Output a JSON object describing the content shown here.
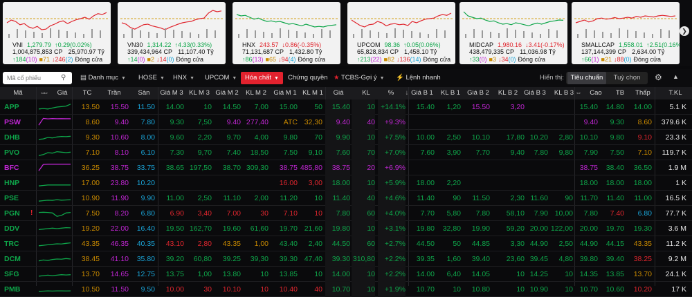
{
  "colors": {
    "up": "#0ea64a",
    "down": "#e0262e",
    "ref": "#c98a00",
    "ceil": "#c026d3",
    "floor": "#1aa3d6",
    "accent": "#e3222e"
  },
  "indices": [
    {
      "name": "VNI",
      "value": "1,279.79",
      "change": "0.29(0.02%)",
      "dir": "up",
      "volume": "1,004,875,853 CP",
      "amount": "25,970.97 Tỷ",
      "adv": "184",
      "adv_c": "(10)",
      "ref": "71",
      "dec": "246",
      "dec_f": "(2)",
      "status": "Đóng cửa",
      "line": [
        0.55,
        0.45,
        0.5,
        0.62,
        0.58,
        0.7,
        0.75,
        0.68,
        0.8,
        0.78,
        0.66,
        0.6,
        0.52,
        0.48,
        0.58,
        0.5,
        0.44,
        0.4,
        0.35,
        0.42,
        0.3,
        0.22,
        0.25,
        0.18
      ]
    },
    {
      "name": "VN30",
      "value": "1,314.22",
      "change": "4.33(0.33%)",
      "dir": "up",
      "volume": "339,434,964 CP",
      "amount": "11,107.40 Tỷ",
      "adv": "14",
      "adv_c": "(0)",
      "ref": "2",
      "dec": "14",
      "dec_f": "(0)",
      "status": "Đóng cửa",
      "line": [
        0.55,
        0.6,
        0.72,
        0.78,
        0.7,
        0.62,
        0.6,
        0.66,
        0.7,
        0.74,
        0.8,
        0.72,
        0.66,
        0.6,
        0.55,
        0.52,
        0.5,
        0.44,
        0.4,
        0.38,
        0.2,
        0.1,
        0.15,
        0.12
      ]
    },
    {
      "name": "HNX",
      "value": "243.57",
      "change": "0.86(-0.35%)",
      "dir": "down",
      "volume": "71,131,687 CP",
      "amount": "1,432.80 Tỷ",
      "adv": "86",
      "adv_c": "(13)",
      "ref": "65",
      "dec": "94",
      "dec_f": "(4)",
      "status": "Đóng cửa",
      "line": [
        0.25,
        0.3,
        0.28,
        0.35,
        0.42,
        0.38,
        0.45,
        0.5,
        0.48,
        0.52,
        0.5,
        0.55,
        0.6,
        0.58,
        0.62,
        0.66,
        0.6,
        0.65,
        0.7,
        0.68,
        0.7,
        0.66,
        0.64,
        0.62
      ]
    },
    {
      "name": "UPCOM",
      "value": "98.36",
      "change": "0.05(0.06%)",
      "dir": "up",
      "volume": "65,828,834 CP",
      "amount": "1,458.10 Tỷ",
      "adv": "213",
      "adv_c": "(22)",
      "ref": "82",
      "dec": "136",
      "dec_f": "(14)",
      "status": "Đóng cửa",
      "line": [
        0.45,
        0.55,
        0.65,
        0.7,
        0.62,
        0.6,
        0.5,
        0.55,
        0.66,
        0.6,
        0.58,
        0.62,
        0.6,
        0.65,
        0.5,
        0.55,
        0.48,
        0.42,
        0.4,
        0.38,
        0.3,
        0.25,
        0.28,
        0.2
      ]
    },
    {
      "name": "MIDCAP",
      "value": "1,980.16",
      "change": "3.41(-0.17%)",
      "dir": "down",
      "volume": "438,479,335 CP",
      "amount": "11,036.98 Tỷ",
      "adv": "33",
      "adv_c": "(0)",
      "ref": "3",
      "dec": "34",
      "dec_f": "(0)",
      "status": "Đóng cửa",
      "line": [
        0.15,
        0.3,
        0.35,
        0.4,
        0.38,
        0.45,
        0.5,
        0.48,
        0.55,
        0.6,
        0.58,
        0.62,
        0.55,
        0.58,
        0.62,
        0.66,
        0.6,
        0.56,
        0.6,
        0.55,
        0.5,
        0.48,
        0.45,
        0.46
      ]
    },
    {
      "name": "SMALLCAP",
      "value": "1,558.01",
      "change": "2.51(0.16%)",
      "dir": "up",
      "volume": "137,144,399 CP",
      "amount": "2,634.00 Tỷ",
      "adv": "66",
      "adv_c": "(1)",
      "ref": "21",
      "dec": "88",
      "dec_f": "(0)",
      "status": "Đóng cửa",
      "line": [
        0.55,
        0.5,
        0.45,
        0.52,
        0.48,
        0.4,
        0.38,
        0.42,
        0.4,
        0.36,
        0.4,
        0.38,
        0.35,
        0.38,
        0.32,
        0.35,
        0.3,
        0.32,
        0.34,
        0.3,
        0.28,
        0.3,
        0.32,
        0.3
      ]
    }
  ],
  "toolbar": {
    "search_placeholder": "Mã cổ phiếu",
    "menu": [
      "Danh mục",
      "HOSE",
      "HNX",
      "UPCOM"
    ],
    "active": "Hóa chất",
    "chung_quyen": "Chứng quyền",
    "tcbs": "TCBS-Gợi ý",
    "lenh_nhanh": "Lệnh nhanh",
    "view_label": "Hiển thị:",
    "view_opts": [
      "Tiêu chuẩn",
      "Tuỳ chọn"
    ]
  },
  "headers": [
    "Mã",
    "",
    "Giá",
    "TC",
    "Trần",
    "Sàn",
    "Giá M 3",
    "KL M 3",
    "Giá M 2",
    "KL M 2",
    "Giá M 1",
    "KL M 1",
    "Giá",
    "KL",
    "%",
    "Giá B 1",
    "KL B 1",
    "Giá B 2",
    "KL B 2",
    "Giá B 3",
    "KL B 3",
    "",
    "Cao",
    "TB",
    "Thấp",
    "T.KL"
  ],
  "rows": [
    {
      "sym": "APP",
      "color": "up",
      "tc": "13.50",
      "tran": "15.50",
      "san": "11.50",
      "gm3": [
        "14.00",
        "up"
      ],
      "klm3": "10",
      "gm2": [
        "14.50",
        "up"
      ],
      "klm2": "7,00",
      "gm1": [
        "15.00",
        "up"
      ],
      "klm1": "50",
      "gia": [
        "15.40",
        "up"
      ],
      "kl": "10",
      "pct": "+14.1%",
      "gb1": [
        "15.40",
        "up"
      ],
      "klb1": "1,20",
      "gb2": [
        "15.50",
        "ce"
      ],
      "klb2": "3,20",
      "gb3": [
        "",
        ""
      ],
      "klb3": "",
      "cao": [
        "15.40",
        "up"
      ],
      "tb": [
        "14.80",
        "up"
      ],
      "thap": [
        "14.00",
        "up"
      ],
      "tkl": "5.1 K",
      "spark": [
        0.3,
        0.35,
        0.3,
        0.4,
        0.5,
        0.55,
        0.6,
        0.8
      ]
    },
    {
      "sym": "PSW",
      "color": "ce",
      "tc": "8.60",
      "tran": "9.40",
      "san": "7.80",
      "gm3": [
        "9.30",
        "up"
      ],
      "klm3": "7,50",
      "gm2": [
        "9.40",
        "ce"
      ],
      "klm2": "277,40",
      "gm1": [
        "ATC",
        "ye"
      ],
      "klm1": "32,30",
      "gia": [
        "9.40",
        "ce"
      ],
      "kl": "40",
      "pct": "+9.3%",
      "gb1": [
        "",
        ""
      ],
      "klb1": "",
      "gb2": [
        "",
        ""
      ],
      "klb2": "",
      "gb3": [
        "",
        ""
      ],
      "klb3": "",
      "cao": [
        "9.40",
        "ce"
      ],
      "tb": [
        "9.30",
        "up"
      ],
      "thap": [
        "8.60",
        "ye"
      ],
      "tkl": "379.6 K",
      "spark": [
        0.2,
        0.9,
        0.85,
        0.88,
        0.86,
        0.87,
        0.86,
        0.86
      ]
    },
    {
      "sym": "DHB",
      "color": "up",
      "tc": "9.30",
      "tran": "10.60",
      "san": "8.00",
      "gm3": [
        "9.60",
        "up"
      ],
      "klm3": "2,20",
      "gm2": [
        "9.70",
        "up"
      ],
      "klm2": "4,00",
      "gm1": [
        "9.80",
        "up"
      ],
      "klm1": "70",
      "gia": [
        "9.90",
        "up"
      ],
      "kl": "10",
      "pct": "+7.5%",
      "gb1": [
        "10.00",
        "up"
      ],
      "klb1": "2,50",
      "gb2": [
        "10.10",
        "up"
      ],
      "klb2": "17,80",
      "gb3": [
        "10.20",
        "up"
      ],
      "klb3": "2,80",
      "cao": [
        "10.10",
        "up"
      ],
      "tb": [
        "9.80",
        "up"
      ],
      "thap": [
        "9.10",
        "dn"
      ],
      "tkl": "23.3 K",
      "spark": [
        0.3,
        0.35,
        0.5,
        0.45,
        0.55,
        0.6,
        0.58,
        0.62
      ]
    },
    {
      "sym": "PVO",
      "color": "up",
      "tc": "7.10",
      "tran": "8.10",
      "san": "6.10",
      "gm3": [
        "7.30",
        "up"
      ],
      "klm3": "9,70",
      "gm2": [
        "7.40",
        "up"
      ],
      "klm2": "18,50",
      "gm1": [
        "7.50",
        "up"
      ],
      "klm1": "9,10",
      "gia": [
        "7.60",
        "up"
      ],
      "kl": "70",
      "pct": "+7.0%",
      "gb1": [
        "7.60",
        "up"
      ],
      "klb1": "3,90",
      "gb2": [
        "7.70",
        "up"
      ],
      "klb2": "9,40",
      "gb3": [
        "7.80",
        "up"
      ],
      "klb3": "9,80",
      "cao": [
        "7.90",
        "up"
      ],
      "tb": [
        "7.50",
        "up"
      ],
      "thap": [
        "7.10",
        "ye"
      ],
      "tkl": "119.7 K",
      "spark": [
        0.2,
        0.3,
        0.5,
        0.45,
        0.6,
        0.55,
        0.5,
        0.55
      ]
    },
    {
      "sym": "BFC",
      "color": "ce",
      "tc": "36.25",
      "tran": "38.75",
      "san": "33.75",
      "gm3": [
        "38.65",
        "up"
      ],
      "klm3": "197,50",
      "gm2": [
        "38.70",
        "up"
      ],
      "klm2": "309,30",
      "gm1": [
        "38.75",
        "ce"
      ],
      "klm1": "485,80",
      "gia": [
        "38.75",
        "ce"
      ],
      "kl": "20",
      "pct": "+6.9%",
      "gb1": [
        "",
        ""
      ],
      "klb1": "",
      "gb2": [
        "",
        ""
      ],
      "klb2": "",
      "gb3": [
        "",
        ""
      ],
      "klb3": "",
      "cao": [
        "38.75",
        "ce"
      ],
      "tb": [
        "38.40",
        "up"
      ],
      "thap": [
        "36.50",
        "up"
      ],
      "tkl": "1.9 M",
      "spark": [
        0.2,
        0.85,
        0.88,
        0.88,
        0.88,
        0.88,
        0.88,
        0.88
      ]
    },
    {
      "sym": "HNP",
      "color": "up",
      "tc": "17.00",
      "tran": "23.80",
      "san": "10.20",
      "gm3": [
        "",
        ""
      ],
      "klm3": "",
      "gm2": [
        "",
        ""
      ],
      "klm2": "",
      "gm1": [
        "16.00",
        "dn"
      ],
      "klm1": "3,00",
      "gia": [
        "18.00",
        "up"
      ],
      "kl": "10",
      "pct": "+5.9%",
      "gb1": [
        "18.00",
        "up"
      ],
      "klb1": "2,20",
      "gb2": [
        "",
        ""
      ],
      "klb2": "",
      "gb3": [
        "",
        ""
      ],
      "klb3": "",
      "cao": [
        "18.00",
        "up"
      ],
      "tb": [
        "18.00",
        "up"
      ],
      "thap": [
        "18.00",
        "up"
      ],
      "tkl": "1 K",
      "spark": [
        0.2,
        0.25,
        0.3,
        0.3,
        0.3,
        0.3,
        0.3,
        0.3
      ]
    },
    {
      "sym": "PSE",
      "color": "up",
      "tc": "10.90",
      "tran": "11.90",
      "san": "9.90",
      "gm3": [
        "11.00",
        "up"
      ],
      "klm3": "2,50",
      "gm2": [
        "11.10",
        "up"
      ],
      "klm2": "2,00",
      "gm1": [
        "11.20",
        "up"
      ],
      "klm1": "10",
      "gia": [
        "11.40",
        "up"
      ],
      "kl": "40",
      "pct": "+4.6%",
      "gb1": [
        "11.40",
        "up"
      ],
      "klb1": "90",
      "gb2": [
        "11.50",
        "up"
      ],
      "klb2": "2,30",
      "gb3": [
        "11.60",
        "up"
      ],
      "klb3": "90",
      "cao": [
        "11.70",
        "up"
      ],
      "tb": [
        "11.40",
        "up"
      ],
      "thap": [
        "11.00",
        "up"
      ],
      "tkl": "16.5 K",
      "spark": [
        0.2,
        0.25,
        0.3,
        0.28,
        0.35,
        0.3,
        0.32,
        0.35
      ]
    },
    {
      "sym": "PGN",
      "color": "up",
      "mark": "!",
      "tc": "7.50",
      "tran": "8.20",
      "san": "6.80",
      "gm3": [
        "6.90",
        "dn"
      ],
      "klm3": "3,40",
      "gm2": [
        "7.00",
        "dn"
      ],
      "klm2": "30",
      "gm1": [
        "7.10",
        "dn"
      ],
      "klm1": "10",
      "gia": [
        "7.80",
        "up"
      ],
      "kl": "60",
      "pct": "+4.0%",
      "gb1": [
        "7.70",
        "up"
      ],
      "klb1": "5,80",
      "gb2": [
        "7.80",
        "up"
      ],
      "klb2": "58,10",
      "gb3": [
        "7.90",
        "up"
      ],
      "klb3": "10,00",
      "cao": [
        "7.80",
        "up"
      ],
      "tb": [
        "7.40",
        "dn"
      ],
      "thap": [
        "6.80",
        "fl"
      ],
      "tkl": "77.7 K",
      "spark": [
        0.6,
        0.62,
        0.6,
        0.55,
        0.2,
        0.3,
        0.55,
        0.6
      ]
    },
    {
      "sym": "DDV",
      "color": "up",
      "tc": "19.20",
      "tran": "22.00",
      "san": "16.40",
      "gm3": [
        "19.50",
        "up"
      ],
      "klm3": "162,70",
      "gm2": [
        "19.60",
        "up"
      ],
      "klm2": "61,60",
      "gm1": [
        "19.70",
        "up"
      ],
      "klm1": "21,60",
      "gia": [
        "19.80",
        "up"
      ],
      "kl": "10",
      "pct": "+3.1%",
      "gb1": [
        "19.80",
        "up"
      ],
      "klb1": "32,80",
      "gb2": [
        "19.90",
        "up"
      ],
      "klb2": "59,20",
      "gb3": [
        "20.00",
        "up"
      ],
      "klb3": "122,00",
      "cao": [
        "20.00",
        "up"
      ],
      "tb": [
        "19.70",
        "up"
      ],
      "thap": [
        "19.30",
        "up"
      ],
      "tkl": "3.6 M",
      "spark": [
        0.4,
        0.45,
        0.5,
        0.55,
        0.5,
        0.55,
        0.6,
        0.58
      ]
    },
    {
      "sym": "TRC",
      "color": "up",
      "tc": "43.35",
      "tran": "46.35",
      "san": "40.35",
      "gm3": [
        "43.10",
        "dn"
      ],
      "klm3": "2,80",
      "gm2": [
        "43.35",
        "ye"
      ],
      "klm2": "1,00",
      "gm1": [
        "43.40",
        "up"
      ],
      "klm1": "2,40",
      "gia": [
        "44.50",
        "up"
      ],
      "kl": "60",
      "pct": "+2.7%",
      "gb1": [
        "44.50",
        "up"
      ],
      "klb1": "50",
      "gb2": [
        "44.85",
        "up"
      ],
      "klb2": "3,30",
      "gb3": [
        "44.90",
        "up"
      ],
      "klb3": "2,50",
      "cao": [
        "44.90",
        "up"
      ],
      "tb": [
        "44.15",
        "up"
      ],
      "thap": [
        "43.35",
        "ye"
      ],
      "tkl": "11.2 K",
      "spark": [
        0.3,
        0.35,
        0.4,
        0.45,
        0.5,
        0.48,
        0.55,
        0.6
      ]
    },
    {
      "sym": "DCM",
      "color": "up",
      "tc": "38.45",
      "tran": "41.10",
      "san": "35.80",
      "gm3": [
        "39.20",
        "up"
      ],
      "klm3": "60,80",
      "gm2": [
        "39.25",
        "up"
      ],
      "klm2": "39,30",
      "gm1": [
        "39.30",
        "up"
      ],
      "klm1": "47,40",
      "gia": [
        "39.30",
        "up"
      ],
      "kl": "310,80",
      "pct": "+2.2%",
      "gb1": [
        "39.35",
        "up"
      ],
      "klb1": "1,60",
      "gb2": [
        "39.40",
        "up"
      ],
      "klb2": "23,60",
      "gb3": [
        "39.45",
        "up"
      ],
      "klb3": "4,80",
      "cao": [
        "39.80",
        "up"
      ],
      "tb": [
        "39.40",
        "up"
      ],
      "thap": [
        "38.25",
        "dn"
      ],
      "tkl": "9.2 M",
      "spark": [
        0.3,
        0.4,
        0.35,
        0.45,
        0.5,
        0.48,
        0.55,
        0.5
      ]
    },
    {
      "sym": "SFG",
      "color": "up",
      "tc": "13.70",
      "tran": "14.65",
      "san": "12.75",
      "gm3": [
        "13.75",
        "up"
      ],
      "klm3": "1,00",
      "gm2": [
        "13.80",
        "up"
      ],
      "klm2": "10",
      "gm1": [
        "13.85",
        "up"
      ],
      "klm1": "10",
      "gia": [
        "14.00",
        "up"
      ],
      "kl": "10",
      "pct": "+2.2%",
      "gb1": [
        "14.00",
        "up"
      ],
      "klb1": "6,40",
      "gb2": [
        "14.05",
        "up"
      ],
      "klb2": "10",
      "gb3": [
        "14.25",
        "up"
      ],
      "klb3": "10",
      "cao": [
        "14.35",
        "up"
      ],
      "tb": [
        "13.85",
        "up"
      ],
      "thap": [
        "13.70",
        "ye"
      ],
      "tkl": "24.1 K",
      "spark": [
        0.3,
        0.35,
        0.4,
        0.35,
        0.4,
        0.45,
        0.42,
        0.45
      ]
    },
    {
      "sym": "PMB",
      "color": "up",
      "tc": "10.50",
      "tran": "11.50",
      "san": "9.50",
      "gm3": [
        "10.00",
        "dn"
      ],
      "klm3": "30",
      "gm2": [
        "10.10",
        "dn"
      ],
      "klm2": "10",
      "gm1": [
        "10.40",
        "dn"
      ],
      "klm1": "40",
      "gia": [
        "10.70",
        "up"
      ],
      "kl": "10",
      "pct": "+1.9%",
      "gb1": [
        "10.70",
        "up"
      ],
      "klb1": "10",
      "gb2": [
        "10.80",
        "up"
      ],
      "klb2": "10",
      "gb3": [
        "10.90",
        "up"
      ],
      "klb3": "10",
      "cao": [
        "10.70",
        "up"
      ],
      "tb": [
        "10.60",
        "up"
      ],
      "thap": [
        "10.20",
        "dn"
      ],
      "tkl": "17 K",
      "spark": [
        0.3,
        0.32,
        0.35,
        0.33,
        0.35,
        0.35,
        0.34,
        0.35
      ]
    }
  ]
}
